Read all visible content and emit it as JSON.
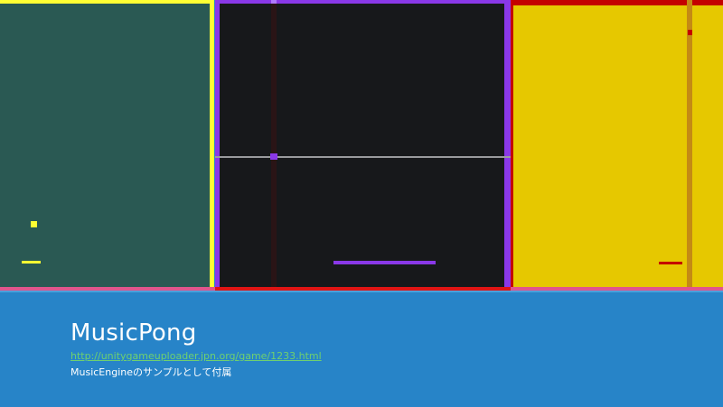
{
  "game": {
    "panels": [
      {
        "id": "green",
        "background": "#2a5953",
        "accent": "#ffff33"
      },
      {
        "id": "dark",
        "background": "#17181b",
        "accent": "#8a38e8"
      },
      {
        "id": "yellow",
        "background": "#e6c800",
        "accent": "#c40000"
      }
    ]
  },
  "caption": {
    "title": "MusicPong",
    "url": "http://unitygameuploader.jpn.org/game/1233.html",
    "description": "MusicEngineのサンプルとして付属"
  },
  "colors": {
    "background": "#2784c8",
    "link": "#6fd06f",
    "text": "#ffffff"
  }
}
